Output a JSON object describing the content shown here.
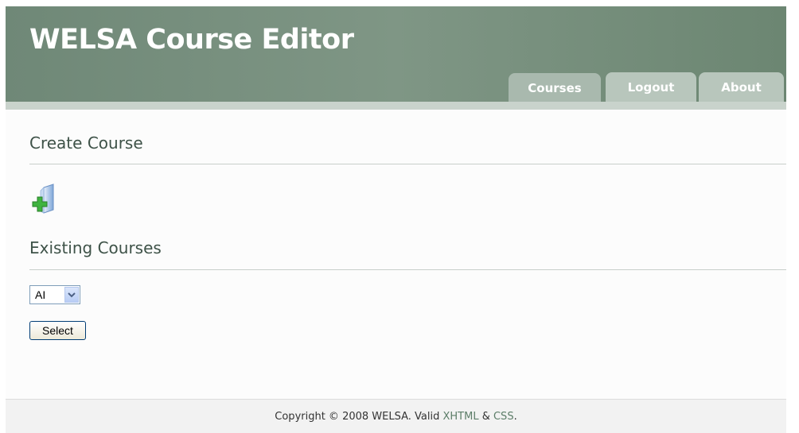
{
  "header": {
    "title": "WELSA Course Editor"
  },
  "tabs": [
    {
      "label": "Courses",
      "active": true
    },
    {
      "label": "Logout",
      "active": false
    },
    {
      "label": "About",
      "active": false
    }
  ],
  "create": {
    "title": "Create Course",
    "icon": "add-folder-icon"
  },
  "existing": {
    "title": "Existing Courses",
    "select_value": "AI",
    "button_label": "Select"
  },
  "footer": {
    "prefix": "Copyright © 2008 WELSA. Valid ",
    "link1": "XHTML",
    "middle": " & ",
    "link2": "CSS",
    "suffix": "."
  },
  "colors": {
    "header_bg": "#7a9180",
    "tab_bg": "#b8c6bc",
    "heading_text": "#3e5248"
  }
}
